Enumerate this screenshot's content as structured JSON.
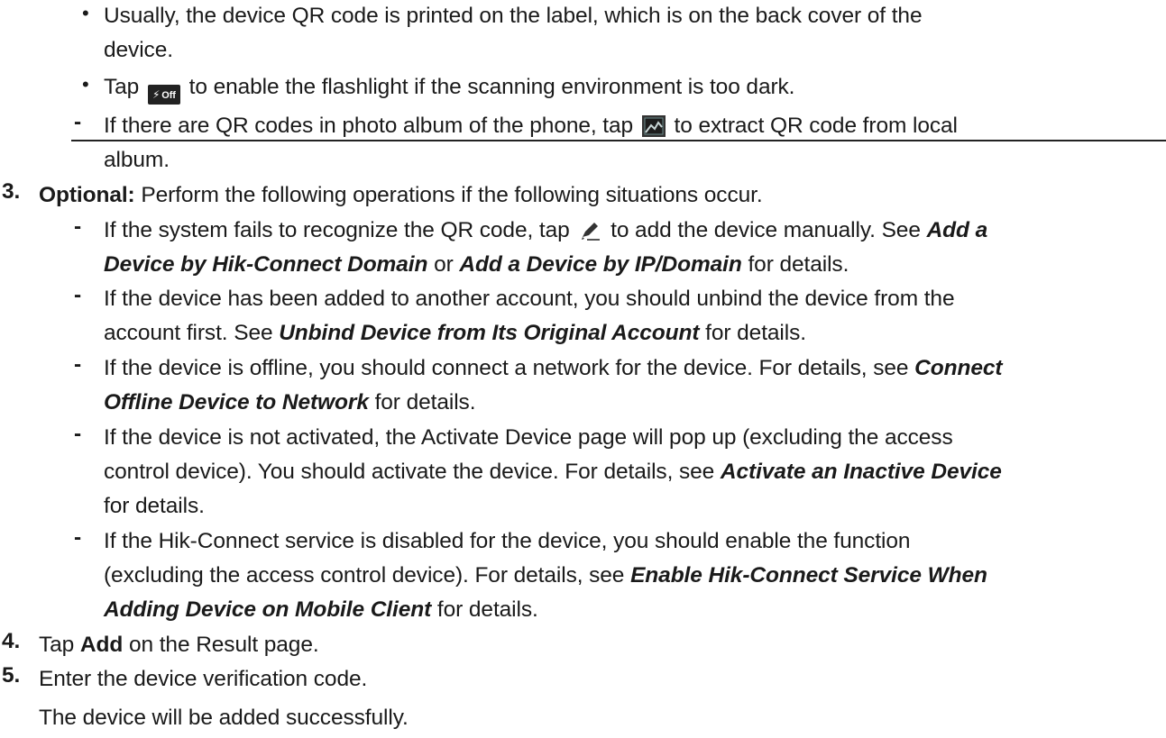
{
  "sub_bullets": {
    "qr_label_line1": "Usually, the device QR code is printed on the label, which is on the back cover of the",
    "qr_label_line2": "device.",
    "flash_before": "Tap",
    "flash_icon_text": "Off",
    "flash_after": "to enable the flashlight if the scanning environment is too dark."
  },
  "album_item": {
    "line1_before": "If there are QR codes in photo album of the phone, tap",
    "line1_after": "to extract QR code from local",
    "line2": "album."
  },
  "step3": {
    "number": "3.",
    "label": "Optional:",
    "text": "Perform the following operations if the following situations occur.",
    "items": {
      "fail_before": "If the system fails to recognize the QR code, tap",
      "fail_after": "to add the device manually. See",
      "fail_link1a": "Add a",
      "fail_link1b": "Device by Hik-Connect Domain",
      "fail_or": "or",
      "fail_link2": "Add a Device by IP/Domain",
      "fail_end": "for details.",
      "bound_line1": "If the device has been added to another account, you should unbind the device from the",
      "bound_before": "account first. See",
      "bound_link": "Unbind Device from Its Original Account",
      "bound_end": "for details.",
      "offline_line1": "If the device is offline, you should connect a network for the device. For details, see",
      "offline_link_a": "Connect",
      "offline_link_b": "Offline Device to Network",
      "offline_end": "for details.",
      "inactive_line1": "If the device is not activated, the Activate Device page will pop up (excluding the access",
      "inactive_line2": "control device). You should activate the device. For details, see",
      "inactive_link": "Activate an Inactive Device",
      "inactive_line3": "for details.",
      "disabled_line1": "If the Hik-Connect service is disabled for the device, you should enable the function",
      "disabled_line2": "(excluding the access control device). For details, see",
      "disabled_link_a": "Enable Hik-Connect Service When",
      "disabled_link_b": "Adding Device on Mobile Client",
      "disabled_end": "for details."
    }
  },
  "step4": {
    "number": "4.",
    "before": "Tap",
    "bold": "Add",
    "after": "on the Result page."
  },
  "step5": {
    "number": "5.",
    "text": "Enter the device verification code.",
    "result": "The device will be added successfully."
  },
  "bullet_char": "•",
  "dash_char": "-"
}
